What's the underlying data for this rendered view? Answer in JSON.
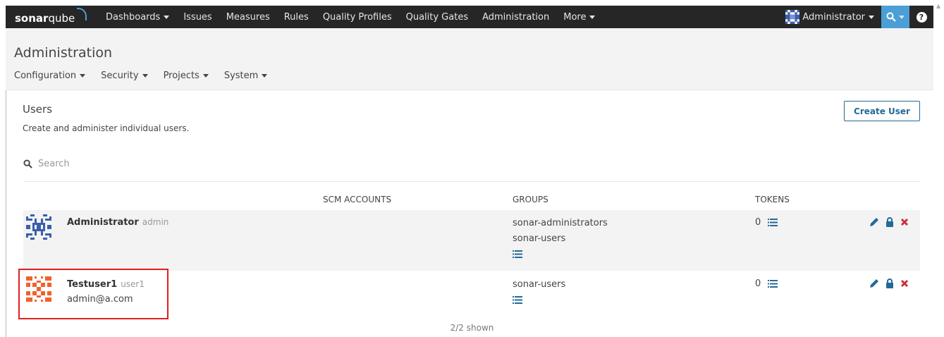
{
  "nav": {
    "logo_bold": "sonar",
    "logo_light": "qube",
    "items": [
      "Dashboards",
      "Issues",
      "Measures",
      "Rules",
      "Quality Profiles",
      "Quality Gates",
      "Administration",
      "More"
    ],
    "user": "Administrator"
  },
  "admin": {
    "title": "Administration",
    "tabs": [
      "Configuration",
      "Security",
      "Projects",
      "System"
    ]
  },
  "page": {
    "title": "Users",
    "description": "Create and administer individual users.",
    "create_button": "Create User",
    "search_placeholder": "Search"
  },
  "table": {
    "headers": {
      "scm": "SCM ACCOUNTS",
      "groups": "GROUPS",
      "tokens": "TOKENS"
    },
    "rows": [
      {
        "name": "Administrator",
        "login": "admin",
        "email": "",
        "groups": [
          "sonar-administrators",
          "sonar-users"
        ],
        "tokens": "0"
      },
      {
        "name": "Testuser1",
        "login": "user1",
        "email": "admin@a.com",
        "groups": [
          "sonar-users"
        ],
        "tokens": "0"
      }
    ],
    "footer": "2/2 shown"
  },
  "colors": {
    "nav_bg": "#262626",
    "accent": "#4b9fd5",
    "button_border": "#236a97",
    "highlight": "#e02020",
    "delete": "#d02f3a",
    "avatar_admin": "#3a5fad",
    "avatar_user": "#f0622d"
  },
  "icons": [
    "search-icon",
    "help-icon",
    "list-icon",
    "edit-icon",
    "lock-icon",
    "delete-icon"
  ]
}
